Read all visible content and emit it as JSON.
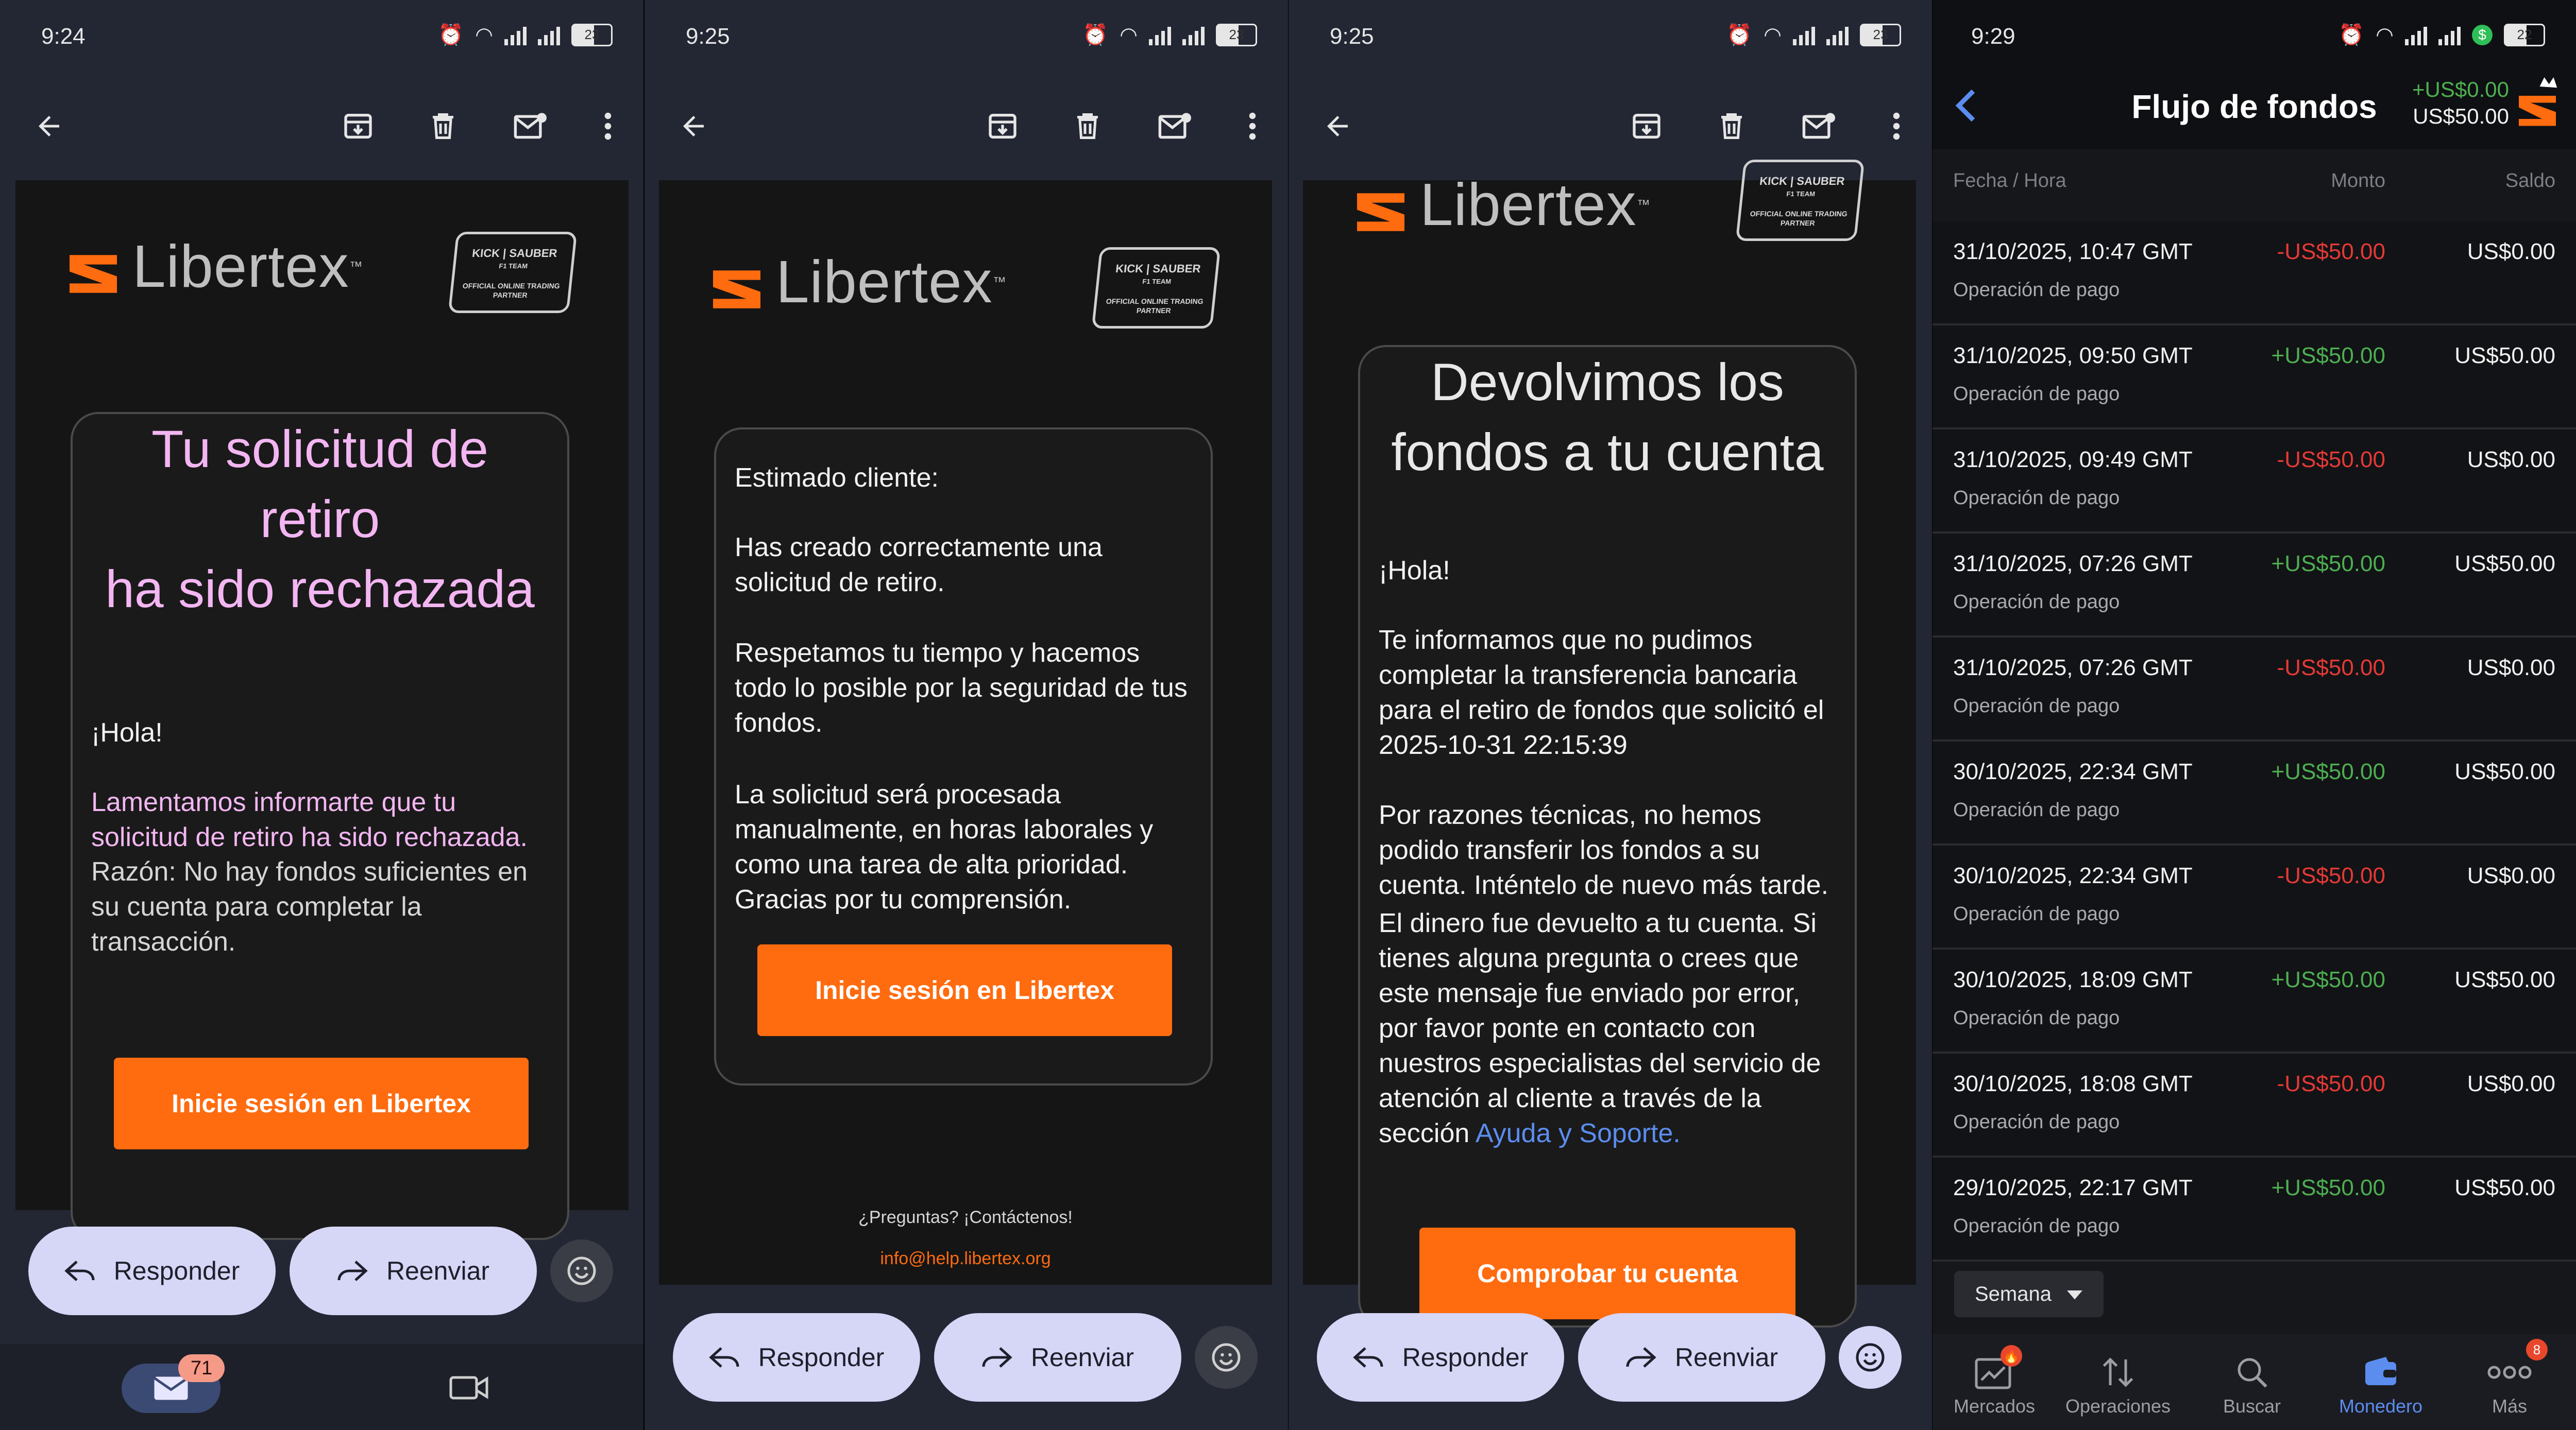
{
  "status_bars": [
    {
      "time": "9:24",
      "battery": "23"
    },
    {
      "time": "9:25",
      "battery": "23"
    },
    {
      "time": "9:25",
      "battery": "23"
    },
    {
      "time": "9:29",
      "battery": "22"
    }
  ],
  "email_toolbar": {
    "back": "back-arrow-icon",
    "archive": "archive-icon",
    "delete": "trash-icon",
    "mark_unread": "mail-unread-icon",
    "more": "more-vert-icon"
  },
  "brand": {
    "name": "Libertex",
    "tm": "™",
    "badge_line1": "KICK | SAUBER",
    "badge_line2": "F1 TEAM",
    "badge_line3": "OFFICIAL ONLINE TRADING PARTNER",
    "accent_color": "#ff6b0f"
  },
  "email1": {
    "title_line1": "Tu solicitud de",
    "title_line2": "retiro",
    "title_line3": "ha sido rechazada",
    "greeting": "¡Hola!",
    "message": "Lamentamos informarte que tu solicitud de retiro ha sido rechazada.",
    "reason": "Razón: No hay fondos suficientes en su cuenta para completar la transacción.",
    "button": "Inicie sesión en Libertex",
    "highlight_color": "#f3b6f2"
  },
  "email2": {
    "salutation": "Estimado cliente:",
    "p1": "Has creado correctamente una solicitud de retiro.",
    "p2": "Respetamos tu tiempo y hacemos todo lo posible por la seguridad de tus fondos.",
    "p3": "La solicitud será procesada manualmente, en horas laborales y como una tarea de alta prioridad. Gracias por tu comprensión.",
    "button": "Inicie sesión en Libertex",
    "footer_question": "¿Preguntas? ¡Contáctenos!",
    "footer_email": "info@help.libertex.org"
  },
  "email3": {
    "title_line1": "Devolvimos los",
    "title_line2": "fondos a tu cuenta",
    "greeting": "¡Hola!",
    "p1": "Te informamos que no pudimos completar la transferencia bancaria para el retiro de fondos que solicitó el 2025-10-31 22:15:39",
    "p2": "Por razones técnicas, no hemos podido transferir los fondos a su cuenta. Inténtelo de nuevo más tarde.",
    "p3_before_link": "El dinero fue devuelto a tu cuenta. Si tienes alguna pregunta o crees que este mensaje fue enviado por error, por favor ponte en contacto con nuestros especialistas del servicio de atención al cliente a través de la sección ",
    "p3_link": "Ayuda y Soporte.",
    "button": "Comprobar tu cuenta"
  },
  "reply_bar": {
    "reply": "Responder",
    "forward": "Reenviar"
  },
  "gmail_nav": {
    "mail_count": "71"
  },
  "wallet": {
    "title": "Flujo de fondos",
    "summary_plus": "+US$0.00",
    "summary_balance": "US$50.00",
    "columns": {
      "date": "Fecha / Hora",
      "amount": "Monto",
      "balance": "Saldo"
    },
    "positive_color": "#4caf50",
    "negative_color": "#e53935",
    "rows": [
      {
        "date": "31/10/2025, 10:47 GMT",
        "type": "Operación de pago",
        "amount": "-US$50.00",
        "balance": "US$0.00",
        "sign": "neg"
      },
      {
        "date": "31/10/2025, 09:50 GMT",
        "type": "Operación de pago",
        "amount": "+US$50.00",
        "balance": "US$50.00",
        "sign": "pos"
      },
      {
        "date": "31/10/2025, 09:49 GMT",
        "type": "Operación de pago",
        "amount": "-US$50.00",
        "balance": "US$0.00",
        "sign": "neg"
      },
      {
        "date": "31/10/2025, 07:26 GMT",
        "type": "Operación de pago",
        "amount": "+US$50.00",
        "balance": "US$50.00",
        "sign": "pos"
      },
      {
        "date": "31/10/2025, 07:26 GMT",
        "type": "Operación de pago",
        "amount": "-US$50.00",
        "balance": "US$0.00",
        "sign": "neg"
      },
      {
        "date": "30/10/2025, 22:34 GMT",
        "type": "Operación de pago",
        "amount": "+US$50.00",
        "balance": "US$50.00",
        "sign": "pos"
      },
      {
        "date": "30/10/2025, 22:34 GMT",
        "type": "Operación de pago",
        "amount": "-US$50.00",
        "balance": "US$0.00",
        "sign": "neg"
      },
      {
        "date": "30/10/2025, 18:09 GMT",
        "type": "Operación de pago",
        "amount": "+US$50.00",
        "balance": "US$50.00",
        "sign": "pos"
      },
      {
        "date": "30/10/2025, 18:08 GMT",
        "type": "Operación de pago",
        "amount": "-US$50.00",
        "balance": "US$0.00",
        "sign": "neg"
      },
      {
        "date": "29/10/2025, 22:17 GMT",
        "type": "Operación de pago",
        "amount": "+US$50.00",
        "balance": "US$50.00",
        "sign": "pos"
      }
    ],
    "period": "Semana",
    "nav": [
      {
        "label": "Mercados",
        "icon": "chart-icon",
        "badge": ""
      },
      {
        "label": "Operaciones",
        "icon": "sort-arrows-icon",
        "badge": ""
      },
      {
        "label": "Buscar",
        "icon": "search-icon",
        "badge": ""
      },
      {
        "label": "Monedero",
        "icon": "wallet-icon",
        "badge": ""
      },
      {
        "label": "Más",
        "icon": "more-dots-icon",
        "badge": "8"
      }
    ],
    "active_nav_color": "#5b8def"
  }
}
